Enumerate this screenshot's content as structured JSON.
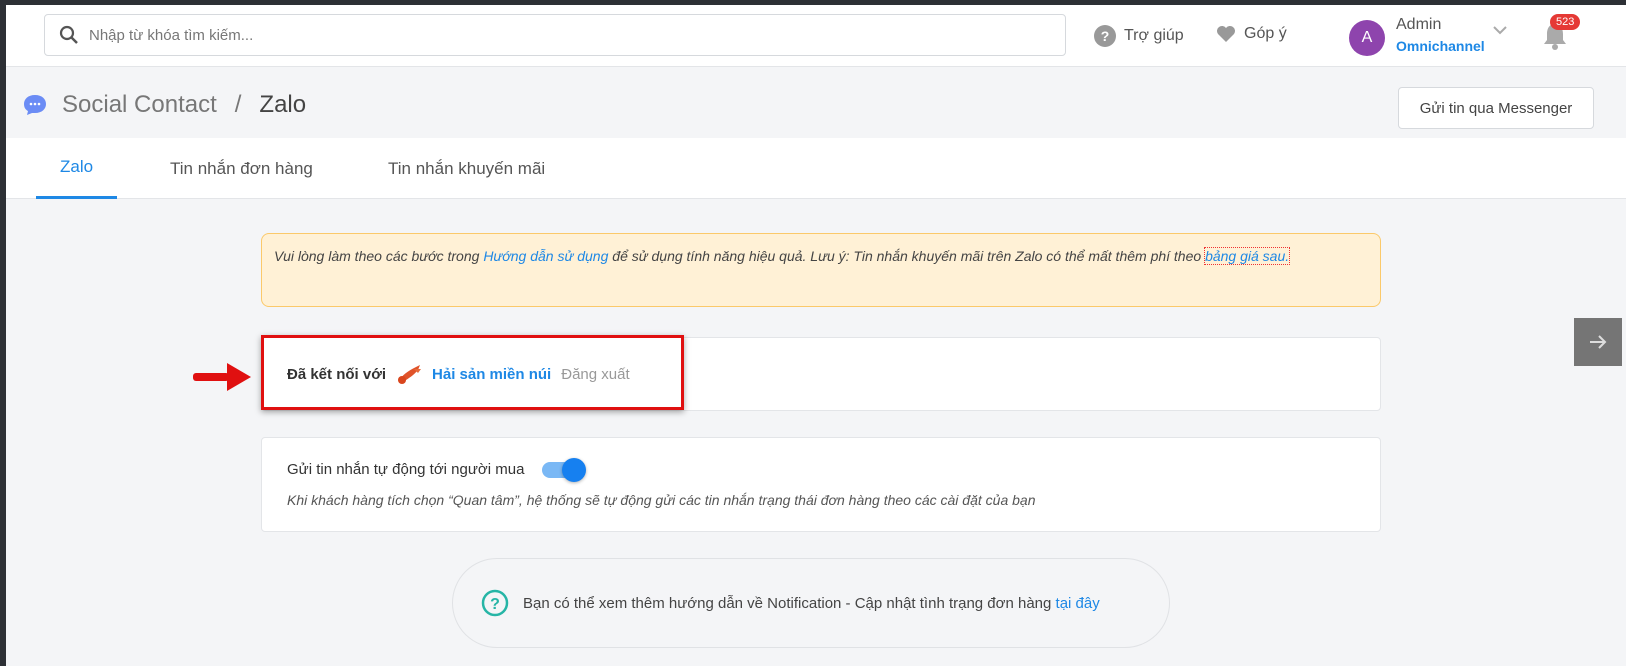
{
  "search": {
    "placeholder": "Nhập từ khóa tìm kiếm..."
  },
  "header": {
    "help": "Trợ giúp",
    "feedback": "Góp ý",
    "user_initial": "A",
    "user_name": "Admin",
    "user_org": "Omnichannel",
    "notif_count": "523"
  },
  "breadcrumb": {
    "parent": "Social Contact",
    "sep": "/",
    "current": "Zalo"
  },
  "messenger_button": "Gửi tin qua Messenger",
  "tabs": [
    {
      "label": "Zalo",
      "active": true
    },
    {
      "label": "Tin nhắn đơn hàng"
    },
    {
      "label": "Tin nhắn khuyến mãi"
    }
  ],
  "notice": {
    "pre": "Vui lòng làm theo các bước trong ",
    "link1": "Hướng dẫn sử dụng",
    "mid": " để sử dụng tính năng hiệu quả. Lưu ý: Tin nhắn khuyến mãi trên Zalo có thể mất thêm phí theo ",
    "link2": "bảng giá sau."
  },
  "connection": {
    "label": "Đã kết nối với",
    "page_name": "Hải sản miền núi",
    "logout": "Đăng xuất"
  },
  "auto_message": {
    "title": "Gửi tin nhắn tự động tới người mua",
    "enabled": true,
    "description": "Khi khách hàng tích chọn “Quan tâm”, hệ thống sẽ tự động gửi các tin nhắn trạng thái đơn hàng theo các cài đặt của bạn"
  },
  "help": {
    "text": "Bạn có thể xem thêm hướng dẫn về Notification - Cập nhật tình trạng đơn hàng ",
    "link": "tại đây"
  },
  "colors": {
    "accent": "#1e88e5",
    "highlight": "#e01010"
  }
}
